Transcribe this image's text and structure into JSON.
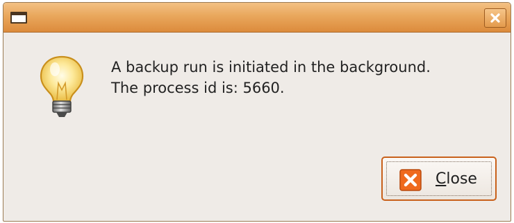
{
  "titlebar": {
    "menu_icon": "window-menu-icon",
    "close_icon": "close-icon"
  },
  "dialog": {
    "icon": "lightbulb-icon",
    "message_line1": "A backup run is initiated in the background.",
    "message_line2": "The process id is: 5660."
  },
  "buttons": {
    "close": {
      "icon": "close-icon",
      "label": "Close",
      "mnemonic": "C",
      "label_rest": "lose"
    }
  },
  "colors": {
    "titlebar_top": "#f3c184",
    "titlebar_bottom": "#dc8b3c",
    "accent": "#e8661e",
    "window_bg": "#efebe7"
  }
}
